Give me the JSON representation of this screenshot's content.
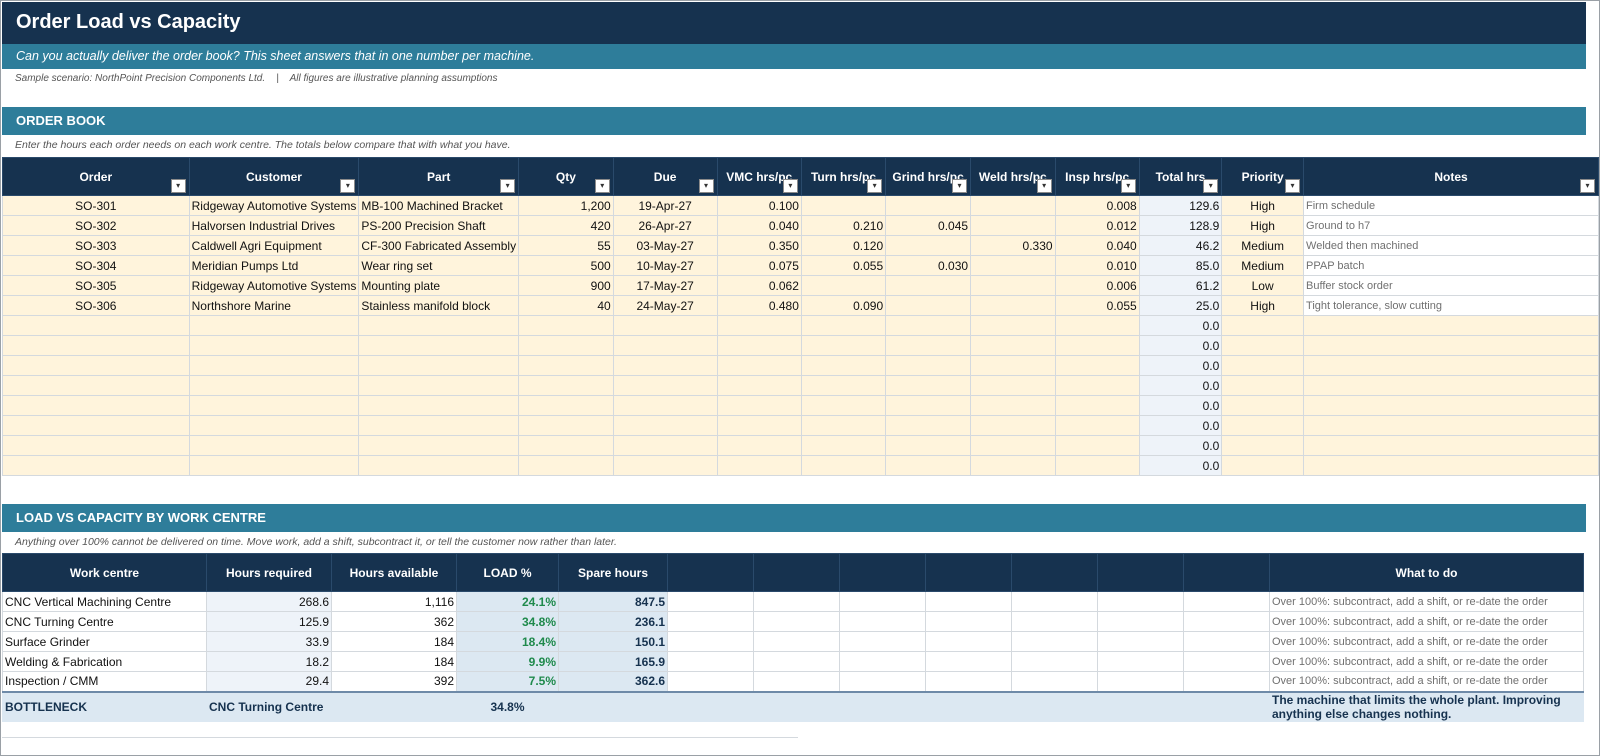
{
  "header": {
    "title": "Order Load vs Capacity",
    "subtitle": "Can you actually deliver the order book? This sheet answers that in one number per machine.",
    "scenario": "Sample scenario: NorthPoint Precision Components Ltd.    |    All figures are illustrative planning assumptions"
  },
  "order_book": {
    "section_title": "ORDER BOOK",
    "note": "Enter the hours each order needs on each work centre. The totals below compare that with what you have.",
    "columns": [
      "Order",
      "Customer",
      "Part",
      "Qty",
      "Due",
      "VMC hrs/pc",
      "Turn hrs/pc",
      "Grind hrs/pc",
      "Weld hrs/pc",
      "Insp hrs/pc",
      "Total hrs",
      "Priority",
      "Notes"
    ],
    "rows": [
      {
        "order": "SO-301",
        "customer": "Ridgeway Automotive Systems",
        "part": "MB-100 Machined Bracket",
        "qty": "1,200",
        "due": "19-Apr-27",
        "vmc": "0.100",
        "turn": "",
        "grind": "",
        "weld": "",
        "insp": "0.008",
        "total": "129.6",
        "priority": "High",
        "notes": "Firm schedule"
      },
      {
        "order": "SO-302",
        "customer": "Halvorsen Industrial Drives",
        "part": "PS-200 Precision Shaft",
        "qty": "420",
        "due": "26-Apr-27",
        "vmc": "0.040",
        "turn": "0.210",
        "grind": "0.045",
        "weld": "",
        "insp": "0.012",
        "total": "128.9",
        "priority": "High",
        "notes": "Ground to h7"
      },
      {
        "order": "SO-303",
        "customer": "Caldwell Agri Equipment",
        "part": "CF-300 Fabricated Assembly",
        "qty": "55",
        "due": "03-May-27",
        "vmc": "0.350",
        "turn": "0.120",
        "grind": "",
        "weld": "0.330",
        "insp": "0.040",
        "total": "46.2",
        "priority": "Medium",
        "notes": "Welded then machined"
      },
      {
        "order": "SO-304",
        "customer": "Meridian Pumps Ltd",
        "part": "Wear ring set",
        "qty": "500",
        "due": "10-May-27",
        "vmc": "0.075",
        "turn": "0.055",
        "grind": "0.030",
        "weld": "",
        "insp": "0.010",
        "total": "85.0",
        "priority": "Medium",
        "notes": "PPAP batch"
      },
      {
        "order": "SO-305",
        "customer": "Ridgeway Automotive Systems",
        "part": "Mounting plate",
        "qty": "900",
        "due": "17-May-27",
        "vmc": "0.062",
        "turn": "",
        "grind": "",
        "weld": "",
        "insp": "0.006",
        "total": "61.2",
        "priority": "Low",
        "notes": "Buffer stock order"
      },
      {
        "order": "SO-306",
        "customer": "Northshore Marine",
        "part": "Stainless manifold block",
        "qty": "40",
        "due": "24-May-27",
        "vmc": "0.480",
        "turn": "0.090",
        "grind": "",
        "weld": "",
        "insp": "0.055",
        "total": "25.0",
        "priority": "High",
        "notes": "Tight tolerance, slow cutting"
      }
    ],
    "empty_total": "0.0",
    "empty_rows": 8
  },
  "load_capacity": {
    "section_title": "LOAD VS CAPACITY BY WORK CENTRE",
    "note": "Anything over 100% cannot be delivered on time. Move work, add a shift, subcontract it, or tell the customer now rather than later.",
    "columns": [
      "Work centre",
      "Hours required",
      "Hours available",
      "LOAD %",
      "Spare hours",
      "What to do"
    ],
    "rows": [
      {
        "centre": "CNC Vertical Machining Centre",
        "required": "268.6",
        "available": "1,116",
        "load": "24.1%",
        "spare": "847.5",
        "action": "Over 100%: subcontract, add a shift, or re-date the order"
      },
      {
        "centre": "CNC Turning Centre",
        "required": "125.9",
        "available": "362",
        "load": "34.8%",
        "spare": "236.1",
        "action": "Over 100%: subcontract, add a shift, or re-date the order"
      },
      {
        "centre": "Surface Grinder",
        "required": "33.9",
        "available": "184",
        "load": "18.4%",
        "spare": "150.1",
        "action": "Over 100%: subcontract, add a shift, or re-date the order"
      },
      {
        "centre": "Welding & Fabrication",
        "required": "18.2",
        "available": "184",
        "load": "9.9%",
        "spare": "165.9",
        "action": "Over 100%: subcontract, add a shift, or re-date the order"
      },
      {
        "centre": "Inspection / CMM",
        "required": "29.4",
        "available": "392",
        "load": "7.5%",
        "spare": "362.6",
        "action": "Over 100%: subcontract, add a shift, or re-date the order"
      }
    ],
    "bottleneck": {
      "label": "BOTTLENECK",
      "centre": "CNC Turning Centre",
      "load": "34.8%",
      "description": "The machine that limits the whole plant. Improving anything else changes nothing."
    }
  },
  "icons": {
    "filter": "dropdown-filter-icon"
  }
}
